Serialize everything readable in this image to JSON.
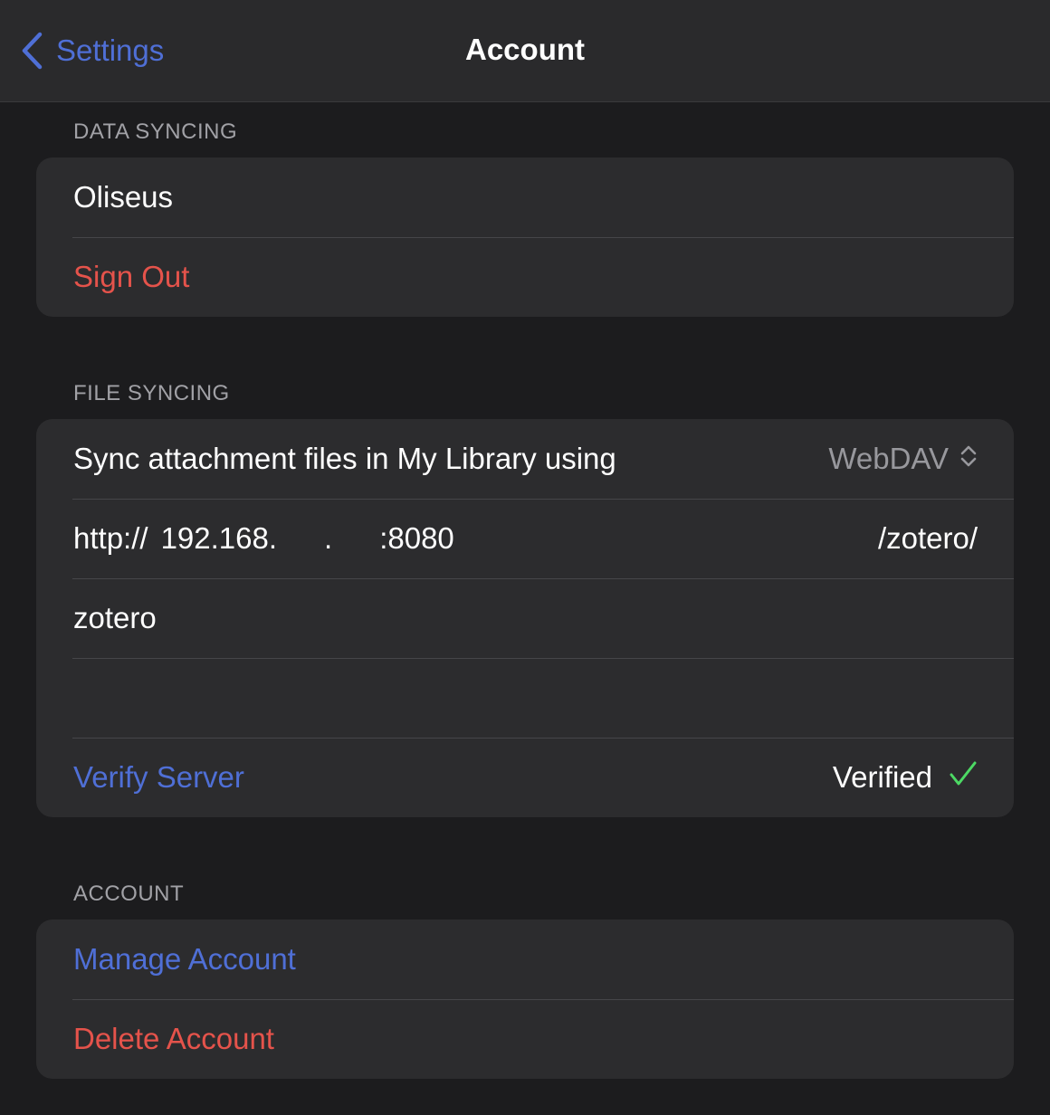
{
  "nav": {
    "back_label": "Settings",
    "title": "Account"
  },
  "data_syncing": {
    "header": "DATA SYNCING",
    "username": "Oliseus",
    "sign_out": "Sign Out"
  },
  "file_syncing": {
    "header": "FILE SYNCING",
    "sync_label": "Sync attachment files in My Library using",
    "sync_value": "WebDAV",
    "url_scheme": "http://",
    "url_host_prefix": "192.168.",
    "url_dot": ".",
    "url_port": ":8080",
    "url_path": "/zotero/",
    "username": "zotero",
    "password": "",
    "verify_label": "Verify Server",
    "verify_status": "Verified"
  },
  "account": {
    "header": "ACCOUNT",
    "manage": "Manage Account",
    "delete": "Delete Account"
  },
  "colors": {
    "accent_blue": "#4f6fd6",
    "destructive_red": "#e5534b",
    "success_green": "#4cd964",
    "background": "#1c1c1e",
    "cell": "#2c2c2e"
  },
  "icons": {
    "back": "chevron-left-icon",
    "picker": "chevron-up-down-icon",
    "verified": "checkmark-icon"
  }
}
